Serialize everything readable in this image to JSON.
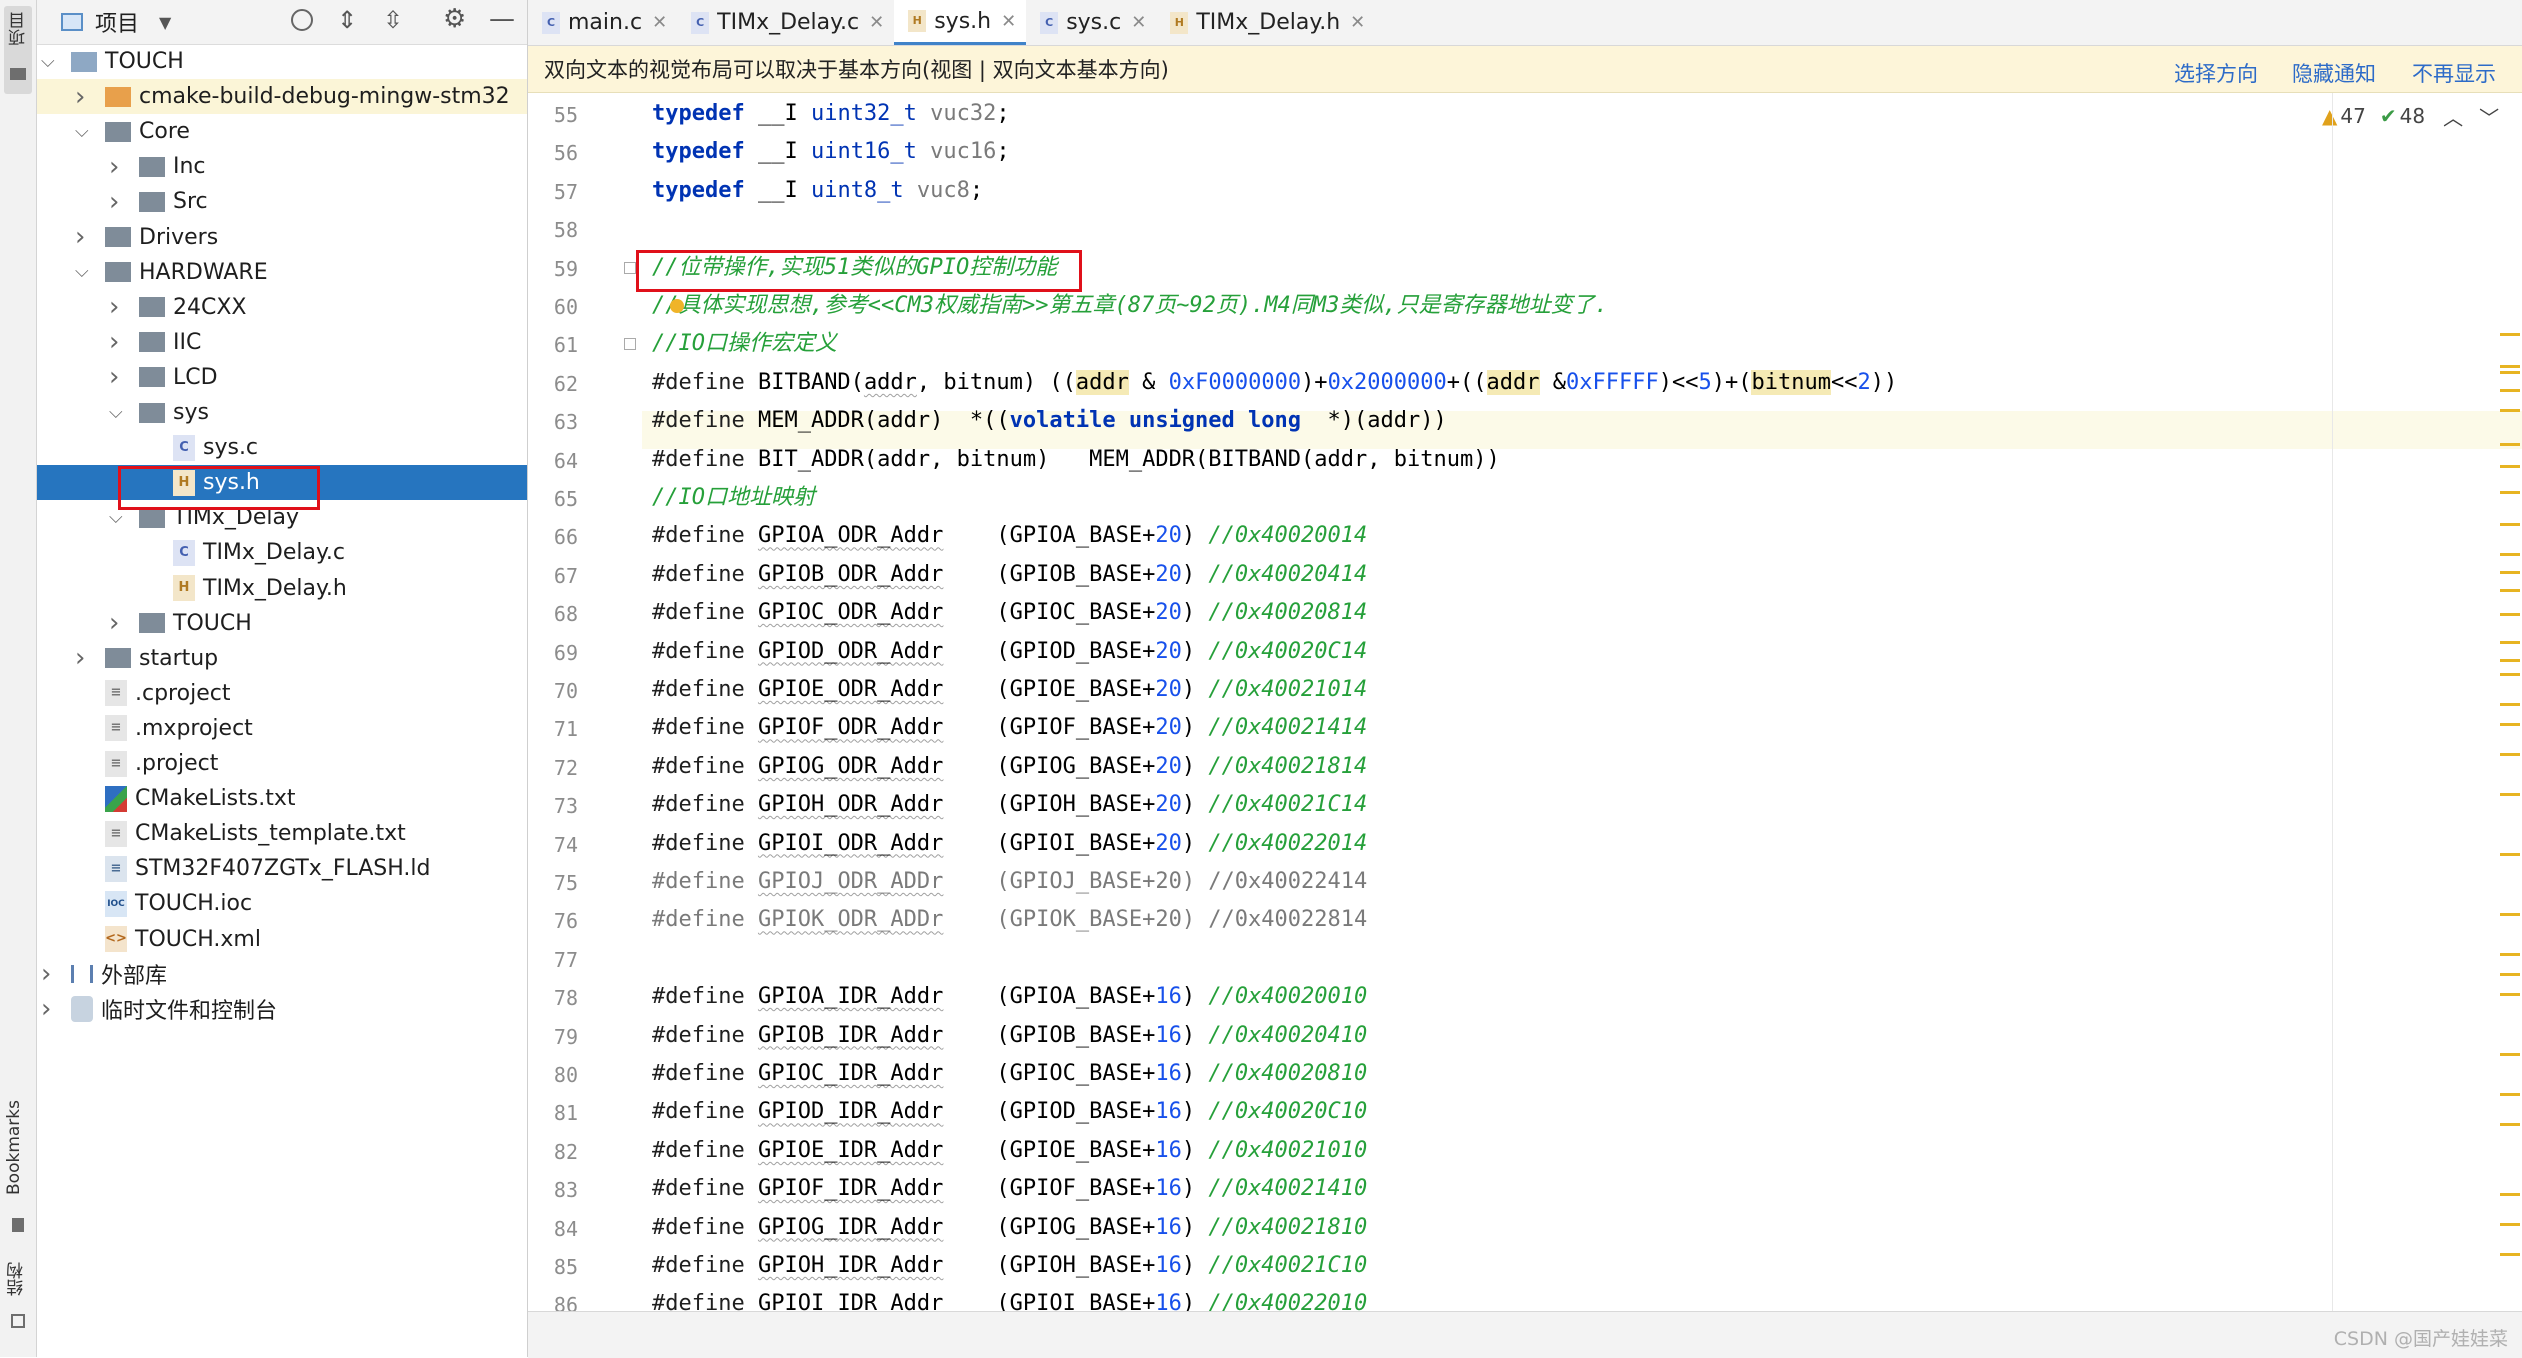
{
  "left_strip": {
    "project_label": "项目",
    "bookmarks_label": "Bookmarks",
    "structure_label": "结构"
  },
  "project_header": {
    "title": "项目"
  },
  "tree": [
    {
      "label": "TOUCH",
      "depth": 0,
      "kind": "root",
      "open": true
    },
    {
      "label": "cmake-build-debug-mingw-stm32",
      "depth": 1,
      "kind": "folder-orange",
      "open": false
    },
    {
      "label": "Core",
      "depth": 1,
      "kind": "folder",
      "open": true
    },
    {
      "label": "Inc",
      "depth": 2,
      "kind": "folder",
      "open": false
    },
    {
      "label": "Src",
      "depth": 2,
      "kind": "folder",
      "open": false
    },
    {
      "label": "Drivers",
      "depth": 1,
      "kind": "folder",
      "open": false
    },
    {
      "label": "HARDWARE",
      "depth": 1,
      "kind": "folder",
      "open": true
    },
    {
      "label": "24CXX",
      "depth": 2,
      "kind": "folder",
      "open": false
    },
    {
      "label": "IIC",
      "depth": 2,
      "kind": "folder",
      "open": false
    },
    {
      "label": "LCD",
      "depth": 2,
      "kind": "folder",
      "open": false
    },
    {
      "label": "sys",
      "depth": 2,
      "kind": "folder",
      "open": true
    },
    {
      "label": "sys.c",
      "depth": 3,
      "kind": "file-c"
    },
    {
      "label": "sys.h",
      "depth": 3,
      "kind": "file-h",
      "selected": true
    },
    {
      "label": "TIMx_Delay",
      "depth": 2,
      "kind": "folder",
      "open": true
    },
    {
      "label": "TIMx_Delay.c",
      "depth": 3,
      "kind": "file-c"
    },
    {
      "label": "TIMx_Delay.h",
      "depth": 3,
      "kind": "file-h"
    },
    {
      "label": "TOUCH",
      "depth": 2,
      "kind": "folder",
      "open": false
    },
    {
      "label": "startup",
      "depth": 1,
      "kind": "folder",
      "open": false
    },
    {
      "label": ".cproject",
      "depth": 1,
      "kind": "file-text"
    },
    {
      "label": ".mxproject",
      "depth": 1,
      "kind": "file-text"
    },
    {
      "label": ".project",
      "depth": 1,
      "kind": "file-text"
    },
    {
      "label": "CMakeLists.txt",
      "depth": 1,
      "kind": "file-cmake"
    },
    {
      "label": "CMakeLists_template.txt",
      "depth": 1,
      "kind": "file-text"
    },
    {
      "label": "STM32F407ZGTx_FLASH.ld",
      "depth": 1,
      "kind": "file-ld"
    },
    {
      "label": "TOUCH.ioc",
      "depth": 1,
      "kind": "file-ioc"
    },
    {
      "label": "TOUCH.xml",
      "depth": 1,
      "kind": "file-xml"
    },
    {
      "label": "外部库",
      "depth": 0,
      "kind": "lib",
      "open": false
    },
    {
      "label": "临时文件和控制台",
      "depth": 0,
      "kind": "scratch",
      "open": false
    }
  ],
  "tabs": [
    {
      "label": "main.c",
      "type": "c"
    },
    {
      "label": "TIMx_Delay.c",
      "type": "c"
    },
    {
      "label": "sys.h",
      "type": "h",
      "active": true
    },
    {
      "label": "sys.c",
      "type": "c"
    },
    {
      "label": "TIMx_Delay.h",
      "type": "h"
    }
  ],
  "notification": {
    "text": "双向文本的视觉布局可以取决于基本方向(视图 | 双向文本基本方向)",
    "link1": "选择方向",
    "link2": "隐藏通知",
    "link3": "不再显示"
  },
  "inspections": {
    "warnings": "47",
    "ok": "48"
  },
  "code_lines": [
    {
      "n": "55",
      "html": "<span class='kw'>typedef</span> __I <span class='ty'>uint32_t</span> <span class='dim'>vuc32</span>;"
    },
    {
      "n": "56",
      "html": "<span class='kw'>typedef</span> __I <span class='ty'>uint16_t</span> <span class='dim'>vuc16</span>;"
    },
    {
      "n": "57",
      "html": "<span class='kw'>typedef</span> __I <span class='ty'>uint8_t</span> <span class='dim'>vuc8</span>;"
    },
    {
      "n": "58",
      "html": ""
    },
    {
      "n": "59",
      "html": "<span class='cmt'>//位带操作,实现51类似的GPIO控制功能</span>"
    },
    {
      "n": "60",
      "html": "<span class='cmt'>//具体实现思想,参考&lt;&lt;CM3权威指南&gt;&gt;第五章(87页~92页).M4同M3类似,只是寄存器地址变了.</span>"
    },
    {
      "n": "61",
      "html": "<span class='cmt'>//IO口操作宏定义</span>"
    },
    {
      "n": "62",
      "html": "<span class='pp'>#define</span> BITBAND(<span class='uw'>addr</span>, bitnum) ((<span class='hlw'>addr</span> &amp; <span class='num'>0xF0000000</span>)+<span class='num'>0x2000000</span>+((<span class='hlw'>addr</span> &amp;<span class='num'>0xFFFFF</span>)&lt;&lt;<span class='num'>5</span>)+(<span class='hlw'>bitnum</span>&lt;&lt;<span class='num'>2</span>))"
    },
    {
      "n": "63",
      "html": "<span class='pp'>#define</span> MEM_ADDR(addr)  *((<span class='kw'>volatile unsigned long</span>  *)(addr))"
    },
    {
      "n": "64",
      "html": "<span class='pp'>#define</span> BIT_ADDR(addr, bitnum)   MEM_ADDR(BITBAND(addr, bitnum))"
    },
    {
      "n": "65",
      "html": "<span class='cmt'>//IO口地址映射</span>"
    },
    {
      "n": "66",
      "html": "<span class='pp'>#define</span> <span class='uw'>GPIOA_ODR_Addr</span>    (GPIOA_BASE+<span class='num'>20</span>) <span class='cmt'>//0x40020014</span>"
    },
    {
      "n": "67",
      "html": "<span class='pp'>#define</span> <span class='uw'>GPIOB_ODR_Addr</span>    (GPIOB_BASE+<span class='num'>20</span>) <span class='cmt'>//0x40020414</span>"
    },
    {
      "n": "68",
      "html": "<span class='pp'>#define</span> <span class='uw'>GPIOC_ODR_Addr</span>    (GPIOC_BASE+<span class='num'>20</span>) <span class='cmt'>//0x40020814</span>"
    },
    {
      "n": "69",
      "html": "<span class='pp'>#define</span> <span class='uw'>GPIOD_ODR_Addr</span>    (GPIOD_BASE+<span class='num'>20</span>) <span class='cmt'>//0x40020C14</span>"
    },
    {
      "n": "70",
      "html": "<span class='pp'>#define</span> <span class='uw'>GPIOE_ODR_Addr</span>    (GPIOE_BASE+<span class='num'>20</span>) <span class='cmt'>//0x40021014</span>"
    },
    {
      "n": "71",
      "html": "<span class='pp'>#define</span> <span class='uw'>GPIOF_ODR_Addr</span>    (GPIOF_BASE+<span class='num'>20</span>) <span class='cmt'>//0x40021414</span>"
    },
    {
      "n": "72",
      "html": "<span class='pp'>#define</span> <span class='uw'>GPIOG_ODR_Addr</span>    (GPIOG_BASE+<span class='num'>20</span>) <span class='cmt'>//0x40021814</span>"
    },
    {
      "n": "73",
      "html": "<span class='pp'>#define</span> <span class='uw'>GPIOH_ODR_Addr</span>    (GPIOH_BASE+<span class='num'>20</span>) <span class='cmt'>//0x40021C14</span>"
    },
    {
      "n": "74",
      "html": "<span class='pp'>#define</span> <span class='uw'>GPIOI_ODR_Addr</span>    (GPIOI_BASE+<span class='num'>20</span>) <span class='cmt'>//0x40022014</span>"
    },
    {
      "n": "75",
      "html": "<span class='dim'>#define <span class='uw'>GPIOJ_ODR_ADDr</span>    (GPIOJ_BASE+20) //0x40022414</span>"
    },
    {
      "n": "76",
      "html": "<span class='dim'>#define <span class='uw'>GPIOK_ODR_ADDr</span>    (GPIOK_BASE+20) //0x40022814</span>"
    },
    {
      "n": "77",
      "html": ""
    },
    {
      "n": "78",
      "html": "<span class='pp'>#define</span> <span class='uw'>GPIOA_IDR_Addr</span>    (GPIOA_BASE+<span class='num'>16</span>) <span class='cmt'>//0x40020010</span>"
    },
    {
      "n": "79",
      "html": "<span class='pp'>#define</span> <span class='uw'>GPIOB_IDR_Addr</span>    (GPIOB_BASE+<span class='num'>16</span>) <span class='cmt'>//0x40020410</span>"
    },
    {
      "n": "80",
      "html": "<span class='pp'>#define</span> <span class='uw'>GPIOC_IDR_Addr</span>    (GPIOC_BASE+<span class='num'>16</span>) <span class='cmt'>//0x40020810</span>"
    },
    {
      "n": "81",
      "html": "<span class='pp'>#define</span> <span class='uw'>GPIOD_IDR_Addr</span>    (GPIOD_BASE+<span class='num'>16</span>) <span class='cmt'>//0x40020C10</span>"
    },
    {
      "n": "82",
      "html": "<span class='pp'>#define</span> <span class='uw'>GPIOE_IDR_Addr</span>    (GPIOE_BASE+<span class='num'>16</span>) <span class='cmt'>//0x40021010</span>"
    },
    {
      "n": "83",
      "html": "<span class='pp'>#define</span> <span class='uw'>GPIOF_IDR_Addr</span>    (GPIOF_BASE+<span class='num'>16</span>) <span class='cmt'>//0x40021410</span>"
    },
    {
      "n": "84",
      "html": "<span class='pp'>#define</span> <span class='uw'>GPIOG_IDR_Addr</span>    (GPIOG_BASE+<span class='num'>16</span>) <span class='cmt'>//0x40021810</span>"
    },
    {
      "n": "85",
      "html": "<span class='pp'>#define</span> <span class='uw'>GPIOH_IDR_Addr</span>    (GPIOH_BASE+<span class='num'>16</span>) <span class='cmt'>//0x40021C10</span>"
    },
    {
      "n": "86",
      "html": "<span class='pp'>#define</span> <span class='uw'>GPIOI_IDR_Addr</span>    (GPIOI_BASE+<span class='num'>16</span>) <span class='cmt'>//0x40022010</span>"
    }
  ],
  "watermark": "CSDN @国产娃娃菜",
  "colors": {
    "selection": "#2675bf",
    "accent": "#4083c9",
    "redbox": "#e0101a"
  }
}
